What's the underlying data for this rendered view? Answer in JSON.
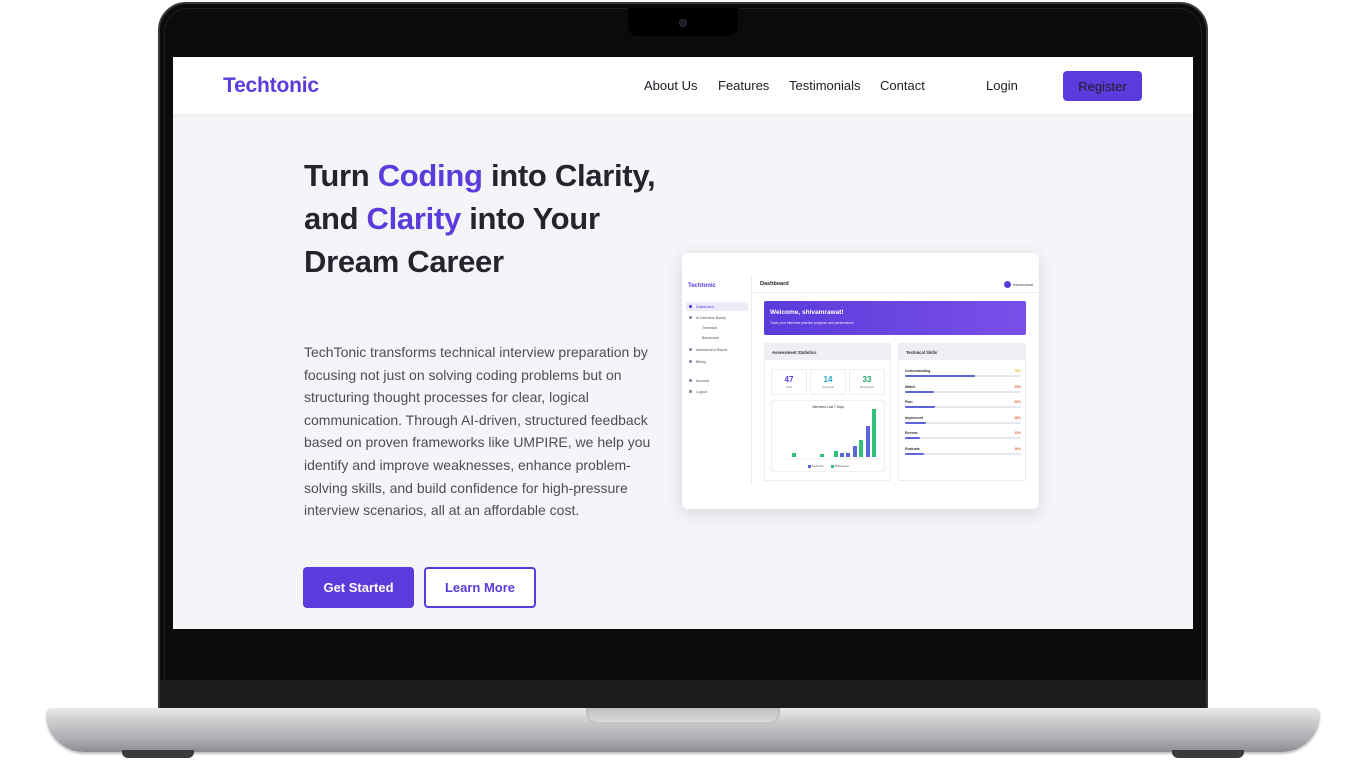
{
  "nav": {
    "brand": "Techtonic",
    "links": [
      "About Us",
      "Features",
      "Testimonials",
      "Contact"
    ],
    "login": "Login",
    "register": "Register"
  },
  "hero": {
    "line1_pre": "Turn ",
    "line1_accent": "Coding",
    "line1_post": " into Clarity,",
    "line2_pre": "and ",
    "line2_accent": "Clarity",
    "line2_post": " into Your Dream Career",
    "description": "TechTonic transforms technical interview preparation by focusing not just on solving coding problems but on structuring thought processes for clear, logical communication. Through AI-driven, structured feedback based on proven frameworks like UMPIRE, we help you identify and improve weaknesses, enhance problem-solving skills, and build confidence for high-pressure interview scenarios, all at an affordable cost.",
    "primary_button": "Get Started",
    "secondary_button": "Learn More"
  },
  "dashboard": {
    "brand": "Techtonic",
    "title": "Dashboard",
    "user": "shivamrawat",
    "sidebar": [
      "Dashboard",
      "AI Interview Buddy",
      "Technical",
      "Behavioral",
      "Assessment Report",
      "Billing",
      "Account",
      "Logout"
    ],
    "welcome_title": "Welcome, shivamrawat!",
    "welcome_sub": "Track your interview practice progress and performance",
    "stats_title": "Assessment Statistics",
    "stats": [
      {
        "value": "47",
        "label": "Total",
        "color": "#5b3bdb"
      },
      {
        "value": "14",
        "label": "Technical",
        "color": "#22a7c9"
      },
      {
        "value": "33",
        "label": "Behavioral",
        "color": "#1fa96a"
      }
    ],
    "chart_title": "Interviews Last 7 Days",
    "legend": [
      "Technical",
      "Behavioral"
    ],
    "skills_title": "Technical Skills",
    "skills": [
      {
        "name": "Understanding",
        "pct": "78%",
        "value": 0.6,
        "pct_color": "#f0b429"
      },
      {
        "name": "Match",
        "pct": "25%",
        "value": 0.25,
        "pct_color": "#e0623a"
      },
      {
        "name": "Plan",
        "pct": "26%",
        "value": 0.26,
        "pct_color": "#e0623a"
      },
      {
        "name": "Implement",
        "pct": "18%",
        "value": 0.18,
        "pct_color": "#e0623a"
      },
      {
        "name": "Review",
        "pct": "13%",
        "value": 0.13,
        "pct_color": "#e0623a"
      },
      {
        "name": "Evaluate",
        "pct": "16%",
        "value": 0.16,
        "pct_color": "#e0623a"
      }
    ]
  },
  "colors": {
    "accent": "#5b3bdb",
    "technical_bar": "#5b64d8",
    "behavioral_bar": "#2fc27a"
  }
}
